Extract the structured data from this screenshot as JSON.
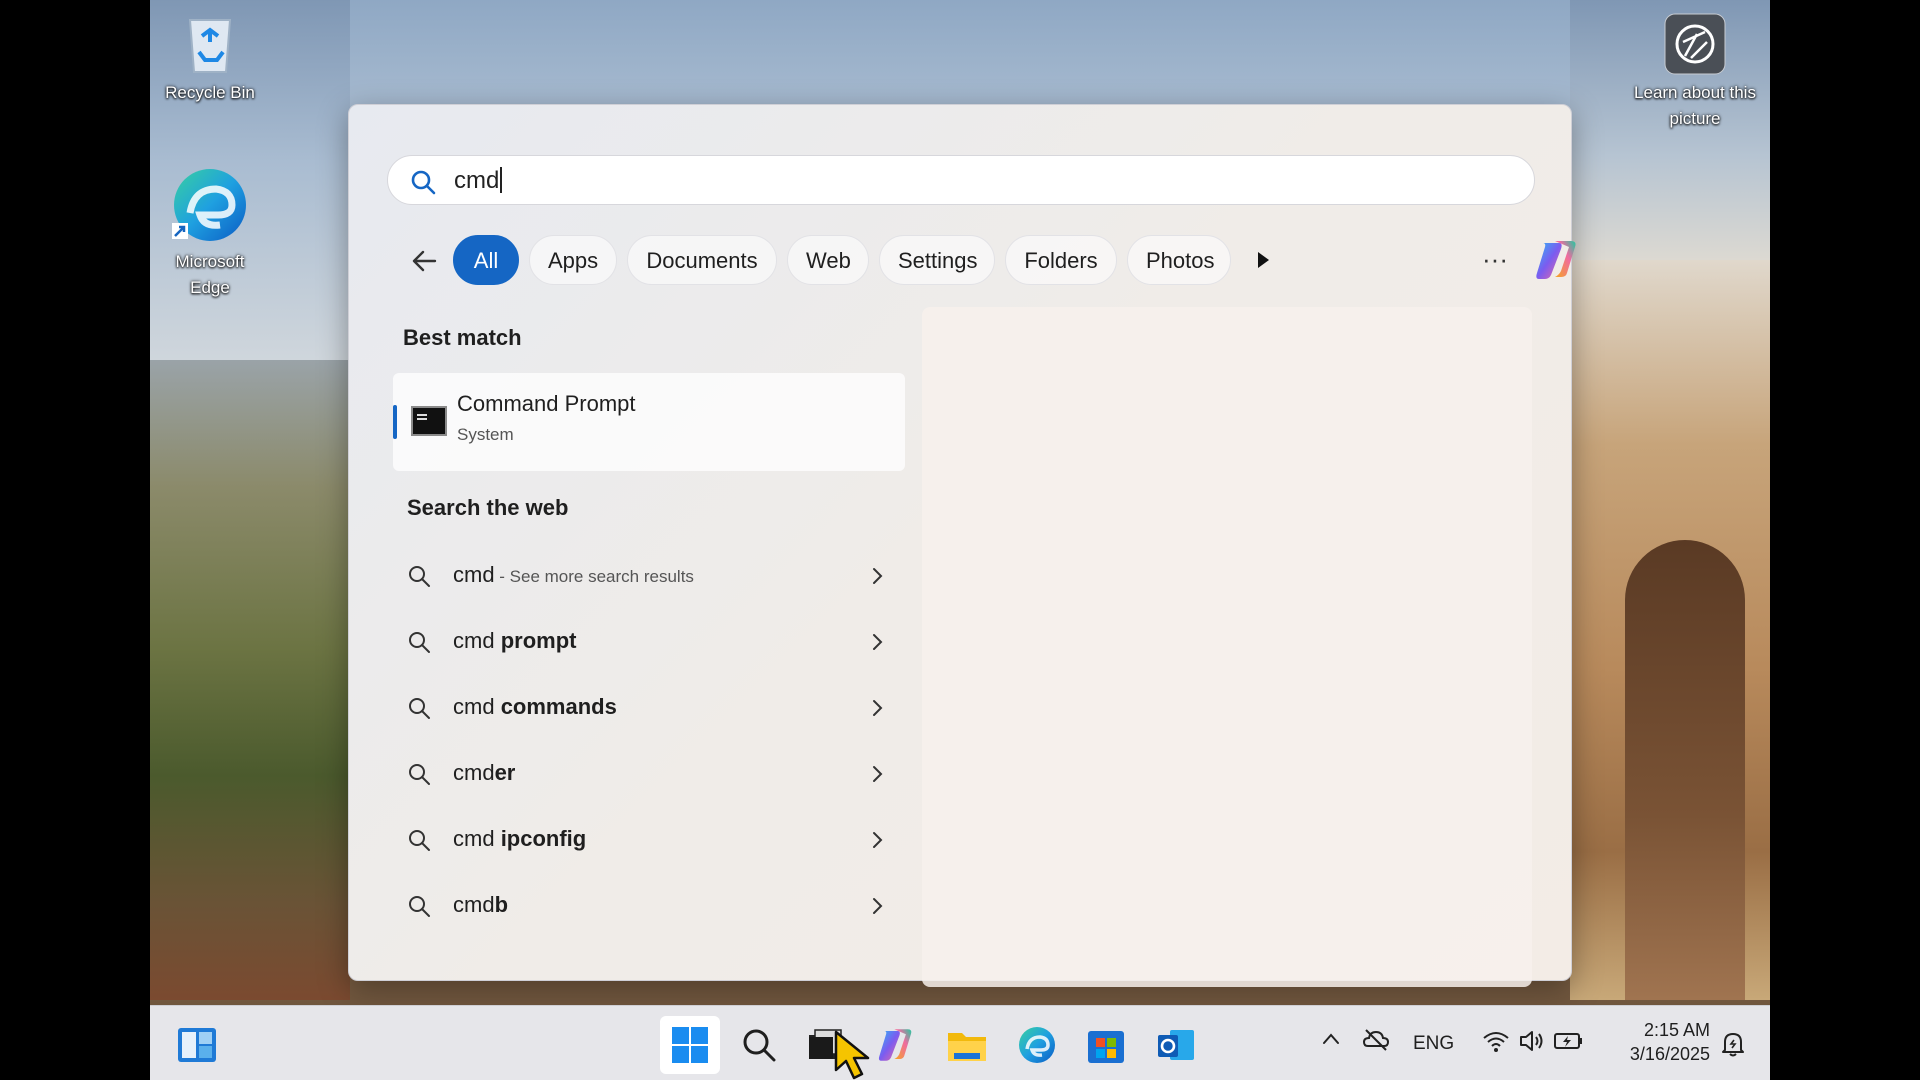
{
  "desktop": {
    "icons": [
      {
        "label": "Recycle Bin"
      },
      {
        "label": "Microsoft Edge"
      },
      {
        "label": "Learn about this picture"
      }
    ]
  },
  "search": {
    "query": "cmd",
    "filters": [
      "All",
      "Apps",
      "Documents",
      "Web",
      "Settings",
      "Folders",
      "Photos"
    ],
    "active_filter": "All",
    "more": "···"
  },
  "best_match": {
    "title": "Best match",
    "name": "Command Prompt",
    "subtitle": "System"
  },
  "web": {
    "title": "Search the web",
    "items": [
      {
        "prefix": "cmd",
        "bold": "",
        "more": " - See more search results"
      },
      {
        "prefix": "cmd ",
        "bold": "prompt",
        "more": ""
      },
      {
        "prefix": "cmd ",
        "bold": "commands",
        "more": ""
      },
      {
        "prefix": "cmd",
        "bold": "er",
        "more": ""
      },
      {
        "prefix": "cmd ",
        "bold": "ipconfig",
        "more": ""
      },
      {
        "prefix": "cmd",
        "bold": "b",
        "more": ""
      }
    ]
  },
  "taskbar": {
    "language": "ENG",
    "time": "2:15 AM",
    "date": "3/16/2025"
  },
  "colors": {
    "accent": "#1566c4"
  }
}
